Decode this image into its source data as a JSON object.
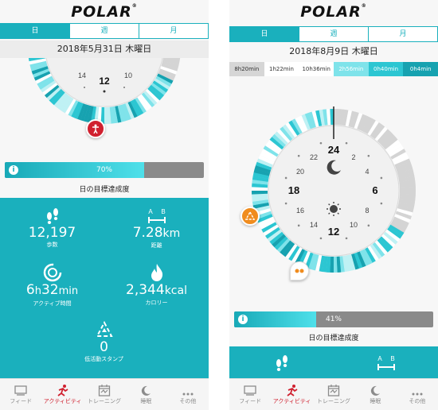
{
  "logo": "POLAR",
  "left": {
    "tabs": [
      "日",
      "週",
      "月"
    ],
    "date": "2018年5月31日 木曜日",
    "dial_labels": [
      "14",
      "10",
      "12"
    ],
    "goal": {
      "percent": "70%",
      "fraction": 0.7,
      "label": "日の目標達成度"
    },
    "stats": {
      "steps": {
        "value": "12,197",
        "label": "歩数",
        "icon": "footsteps-icon"
      },
      "distance": {
        "value": "7.28",
        "unit": "km",
        "label": "距離",
        "icon": "distance-icon"
      },
      "active": {
        "value_h": "6",
        "h": "h",
        "value_m": "32",
        "unit": "min",
        "label": "アクティブ時間",
        "icon": "active-time-icon"
      },
      "calories": {
        "value": "2,344",
        "unit": "kcal",
        "label": "カロリー",
        "icon": "flame-icon"
      },
      "inactivity": {
        "value": "0",
        "label": "低活動スタンプ",
        "icon": "inactivity-stamp-icon"
      }
    }
  },
  "right": {
    "tabs": [
      "日",
      "週",
      "月"
    ],
    "date": "2018年8月9日 木曜日",
    "durations": [
      "8h20min",
      "1h22min",
      "10h36min",
      "2h56min",
      "0h40min",
      "0h4min"
    ],
    "duration_colors": [
      "#d6d6d6",
      "#ffffff",
      "#ffffff",
      "#7fe3ea",
      "#2cc6d2",
      "#17a2b0"
    ],
    "dial": {
      "top": "24",
      "bottom": "12",
      "left": "18",
      "right": "6",
      "nums": [
        "22",
        "2",
        "20",
        "4",
        "16",
        "8",
        "14",
        "10"
      ]
    },
    "goal": {
      "percent": "41%",
      "fraction": 0.41,
      "label": "日の目標達成度"
    }
  },
  "nav": [
    {
      "label": "フィード",
      "icon": "feed-icon"
    },
    {
      "label": "アクティビティ",
      "icon": "activity-icon"
    },
    {
      "label": "トレーニング",
      "icon": "training-calendar-icon"
    },
    {
      "label": "睡眠",
      "icon": "moon-icon"
    },
    {
      "label": "その他",
      "icon": "more-icon"
    }
  ],
  "colors": {
    "teal": "#1ab0bd",
    "red": "#d0202f",
    "orange": "#f08c1e"
  }
}
